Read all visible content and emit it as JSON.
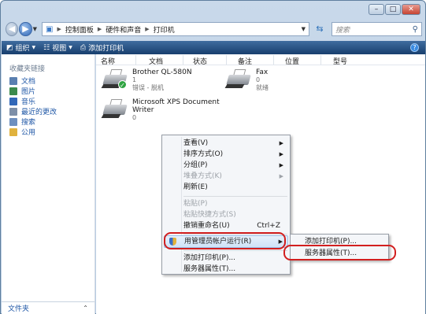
{
  "address": {
    "crumbs": [
      "控制面板",
      "硬件和声音",
      "打印机"
    ]
  },
  "search": {
    "placeholder": "搜索"
  },
  "toolbar": {
    "organize": "组织",
    "views": "视图",
    "add_printer": "添加打印机"
  },
  "sidebar": {
    "title": "收藏夹链接",
    "links": [
      {
        "label": "文档",
        "color": "#5a7fb0"
      },
      {
        "label": "图片",
        "color": "#3b8a4c"
      },
      {
        "label": "音乐",
        "color": "#3268b8"
      },
      {
        "label": "最近的更改",
        "color": "#7d8fa8"
      },
      {
        "label": "搜索",
        "color": "#6d8fbf"
      },
      {
        "label": "公用",
        "color": "#e0b23e"
      }
    ],
    "folders_label": "文件夹"
  },
  "columns": [
    "名称",
    "文档",
    "状态",
    "备注",
    "位置",
    "型号"
  ],
  "printers": [
    {
      "name": "Brother QL-580N",
      "docs": "1",
      "status": "错误 - 脱机"
    },
    {
      "name_line1": "Microsoft XPS Document",
      "name_line2": "Writer",
      "docs": "0"
    },
    {
      "name": "Fax",
      "docs": "0",
      "status": "就绪"
    }
  ],
  "context_menu": {
    "view": "查看(V)",
    "sort": "排序方式(O)",
    "group": "分组(P)",
    "stack": "堆叠方式(K)",
    "refresh": "刷新(E)",
    "paste": "粘贴(P)",
    "paste_shortcut": "粘贴快捷方式(S)",
    "undo": "撤销重命名(U)",
    "undo_shortcut": "Ctrl+Z",
    "run_as_admin": "用管理员帐户运行(R)",
    "add_printer": "添加打印机(P)...",
    "server_props": "服务器属性(T)..."
  },
  "submenu": {
    "add_printer": "添加打印机(P)...",
    "server_props": "服务器属性(T)..."
  },
  "colors": {
    "highlight_ring": "#d21f1f",
    "toolbar": "#214a7c"
  }
}
